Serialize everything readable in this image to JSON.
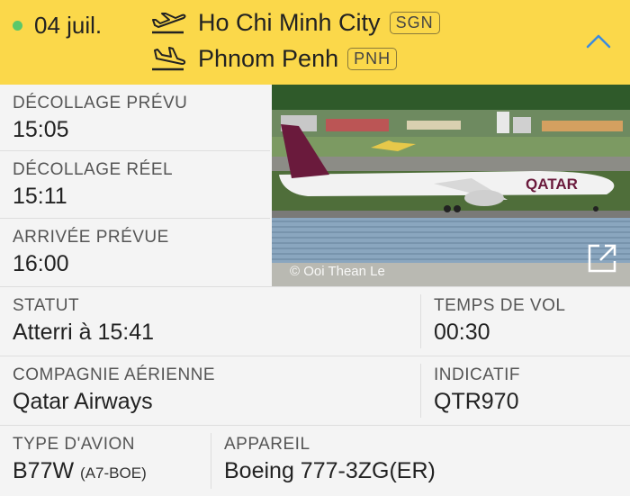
{
  "header": {
    "date": "04 juil.",
    "departure": {
      "city": "Ho Chi Minh City",
      "code": "SGN"
    },
    "arrival": {
      "city": "Phnom Penh",
      "code": "PNH"
    },
    "status_color": "#5cc86a",
    "background": "#fbd84a"
  },
  "times": {
    "scheduled_departure": {
      "label": "DÉCOLLAGE PRÉVU",
      "value": "15:05"
    },
    "actual_departure": {
      "label": "DÉCOLLAGE RÉEL",
      "value": "15:11"
    },
    "scheduled_arrival": {
      "label": "ARRIVÉE PRÉVUE",
      "value": "16:00"
    }
  },
  "photo": {
    "credit": "© Ooi Thean Le",
    "airline_livery": "QATAR"
  },
  "status": {
    "label": "STATUT",
    "value": "Atterri à 15:41"
  },
  "flight_time": {
    "label": "TEMPS DE VOL",
    "value": "00:30"
  },
  "airline": {
    "label": "COMPAGNIE AÉRIENNE",
    "value": "Qatar Airways"
  },
  "callsign": {
    "label": "INDICATIF",
    "value": "QTR970"
  },
  "aircraft_type": {
    "label": "TYPE D'AVION",
    "value": "B77W",
    "registration": "(A7-BOE)"
  },
  "aircraft": {
    "label": "APPAREIL",
    "value": "Boeing 777-3ZG(ER)"
  }
}
